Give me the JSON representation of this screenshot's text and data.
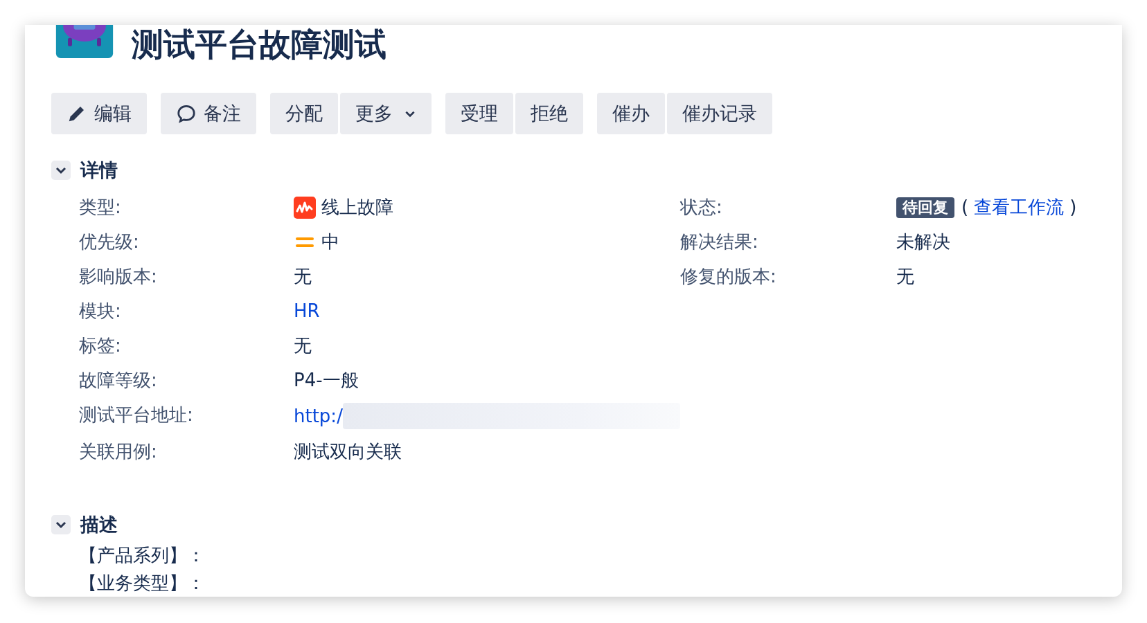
{
  "issue": {
    "title": "测试平台故障测试"
  },
  "button_groups": [
    [
      {
        "label": "编辑",
        "kind": "edit"
      }
    ],
    [
      {
        "label": "备注",
        "kind": "comment"
      }
    ],
    [
      {
        "label": "分配",
        "kind": "plain"
      },
      {
        "label": "更多",
        "kind": "dropdown"
      }
    ],
    [
      {
        "label": "受理",
        "kind": "plain"
      },
      {
        "label": "拒绝",
        "kind": "plain"
      }
    ],
    [
      {
        "label": "催办",
        "kind": "plain"
      },
      {
        "label": "催办记录",
        "kind": "plain"
      }
    ]
  ],
  "details": {
    "title": "详情",
    "expanded": true,
    "left_fields": [
      {
        "label": "类型:",
        "kind": "type",
        "value": "线上故障"
      },
      {
        "label": "优先级:",
        "kind": "priority",
        "value": "中"
      },
      {
        "label": "影响版本:",
        "kind": "text",
        "value": "无"
      },
      {
        "label": "模块:",
        "kind": "link",
        "value": "HR"
      },
      {
        "label": "标签:",
        "kind": "text",
        "value": "无"
      },
      {
        "label": "故障等级:",
        "kind": "text",
        "value": "P4-一般"
      },
      {
        "label": "测试平台地址:",
        "kind": "redacted",
        "value": "http:/"
      },
      {
        "label": "关联用例:",
        "kind": "text",
        "value": "测试双向关联"
      }
    ],
    "right_fields": [
      {
        "label": "状态:",
        "kind": "status",
        "badge": "待回复",
        "prefix": "(",
        "link": "查看工作流",
        "suffix": ")"
      },
      {
        "label": "解决结果:",
        "kind": "text",
        "value": "未解决"
      },
      {
        "label": "修复的版本:",
        "kind": "text",
        "value": "无"
      }
    ]
  },
  "description": {
    "title": "描述",
    "expanded": true,
    "lines": [
      "【产品系列】：",
      "【业务类型】："
    ]
  }
}
